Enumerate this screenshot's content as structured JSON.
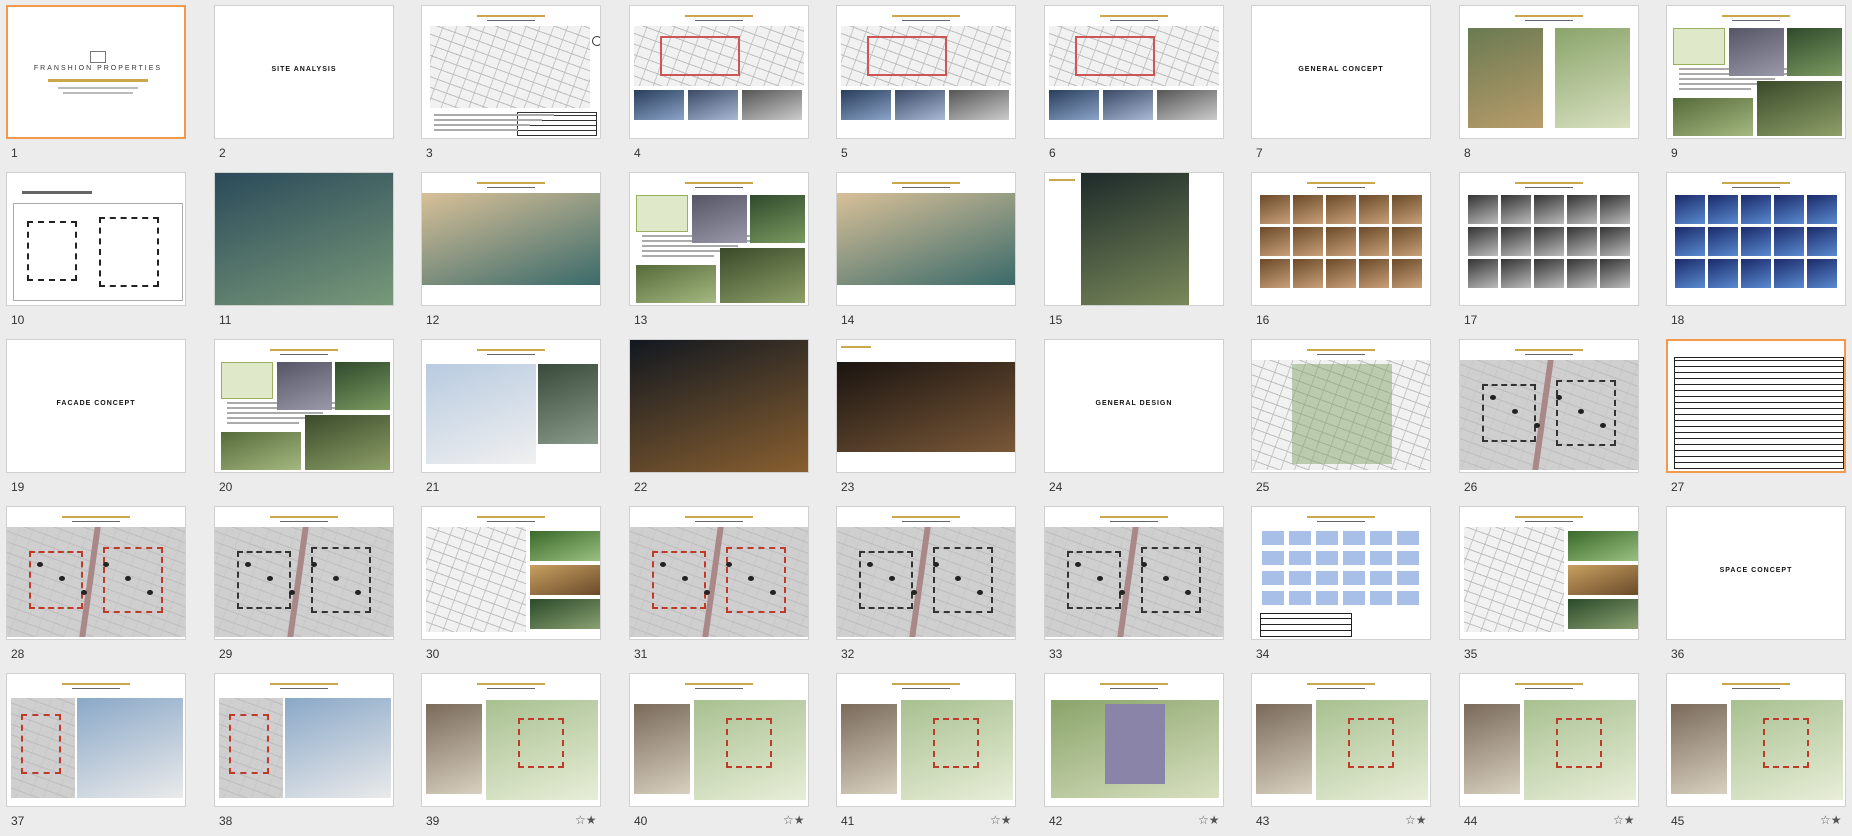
{
  "slides": [
    {
      "n": "1",
      "kind": "cover",
      "star": false,
      "selected": true
    },
    {
      "n": "2",
      "kind": "text",
      "label": "SITE ANALYSIS",
      "star": false
    },
    {
      "n": "3",
      "kind": "map",
      "star": false
    },
    {
      "n": "4",
      "kind": "map-photos",
      "star": false
    },
    {
      "n": "5",
      "kind": "map-photos",
      "star": false
    },
    {
      "n": "6",
      "kind": "map-photos",
      "star": false
    },
    {
      "n": "7",
      "kind": "text",
      "label": "GENERAL CONCEPT",
      "star": false
    },
    {
      "n": "8",
      "kind": "plans",
      "star": false
    },
    {
      "n": "9",
      "kind": "photos",
      "star": false
    },
    {
      "n": "10",
      "kind": "plan",
      "star": false
    },
    {
      "n": "11",
      "kind": "aerial",
      "star": false
    },
    {
      "n": "12",
      "kind": "render",
      "star": false
    },
    {
      "n": "13",
      "kind": "photos",
      "star": false
    },
    {
      "n": "14",
      "kind": "render",
      "star": false
    },
    {
      "n": "15",
      "kind": "render-night",
      "star": false
    },
    {
      "n": "16",
      "kind": "collage",
      "star": false
    },
    {
      "n": "17",
      "kind": "collage-bw",
      "star": false
    },
    {
      "n": "18",
      "kind": "collage-blue",
      "star": false
    },
    {
      "n": "19",
      "kind": "text",
      "label": "FACADE CONCEPT",
      "star": false
    },
    {
      "n": "20",
      "kind": "photos",
      "star": false
    },
    {
      "n": "21",
      "kind": "building",
      "star": false
    },
    {
      "n": "22",
      "kind": "night-entrance",
      "star": false
    },
    {
      "n": "23",
      "kind": "dark-interior",
      "star": false
    },
    {
      "n": "24",
      "kind": "text",
      "label": "GENERAL DESIGN",
      "star": false
    },
    {
      "n": "25",
      "kind": "site-plan",
      "star": false
    },
    {
      "n": "26",
      "kind": "site-plan-grey",
      "star": false
    },
    {
      "n": "27",
      "kind": "table",
      "star": false,
      "selected": true
    },
    {
      "n": "28",
      "kind": "site-plan-grey",
      "star": false
    },
    {
      "n": "29",
      "kind": "site-plan-grey",
      "star": false
    },
    {
      "n": "30",
      "kind": "plan-photos",
      "star": false
    },
    {
      "n": "31",
      "kind": "site-plan-grey",
      "star": false
    },
    {
      "n": "32",
      "kind": "site-plan-grey",
      "star": false
    },
    {
      "n": "33",
      "kind": "site-plan-grey",
      "star": false
    },
    {
      "n": "34",
      "kind": "blue-plan",
      "star": false
    },
    {
      "n": "35",
      "kind": "plan-photos",
      "star": false
    },
    {
      "n": "36",
      "kind": "text",
      "label": "SPACE CONCEPT",
      "star": false
    },
    {
      "n": "37",
      "kind": "plan-building",
      "star": false
    },
    {
      "n": "38",
      "kind": "plan-building",
      "star": false
    },
    {
      "n": "39",
      "kind": "landscape",
      "star": true
    },
    {
      "n": "40",
      "kind": "landscape",
      "star": true
    },
    {
      "n": "41",
      "kind": "landscape",
      "star": true
    },
    {
      "n": "42",
      "kind": "landscape-wide",
      "star": true
    },
    {
      "n": "43",
      "kind": "landscape",
      "star": true
    },
    {
      "n": "44",
      "kind": "landscape",
      "star": true
    },
    {
      "n": "45",
      "kind": "landscape",
      "star": true
    }
  ],
  "icons": {
    "animation": "animation-star-icon",
    "cover_logo": "logo-icon"
  },
  "colors": {
    "selection": "#f39a4a",
    "accent": "#c9a74a"
  },
  "cover": {
    "brand": "FRANSHION PROPERTIES"
  },
  "star_glyph": "☆★"
}
